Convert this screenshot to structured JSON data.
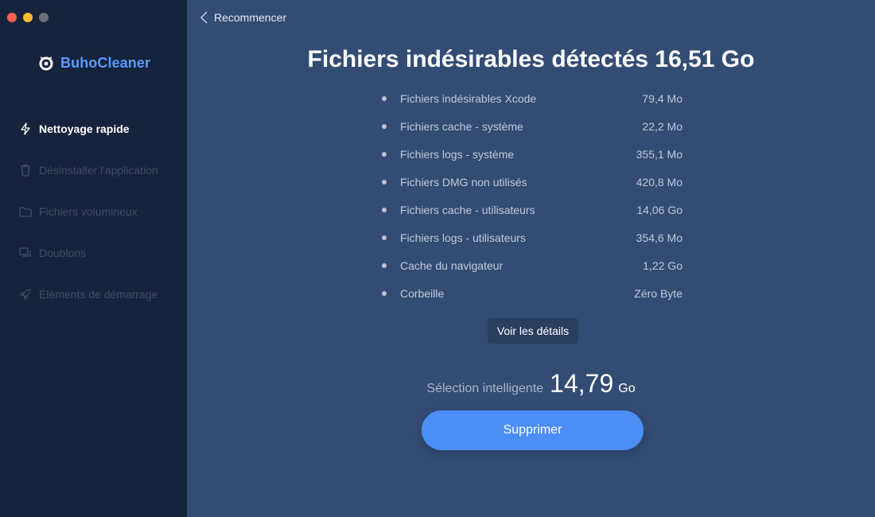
{
  "app": {
    "name": "BuhoCleaner"
  },
  "colors": {
    "accent": "#4b8ef5",
    "brand": "#5a9bff",
    "sidebar_bg": "#16233d",
    "main_bg": "#334c74"
  },
  "sidebar": {
    "items": [
      {
        "label": "Nettoyage rapide",
        "icon": "lightning-icon",
        "active": true
      },
      {
        "label": "Désinstaller l'application",
        "icon": "trash-icon",
        "active": false
      },
      {
        "label": "Fichiers volumineux",
        "icon": "folder-icon",
        "active": false
      },
      {
        "label": "Doublons",
        "icon": "duplicates-icon",
        "active": false
      },
      {
        "label": "Éléments de démarrage",
        "icon": "rocket-icon",
        "active": false
      }
    ]
  },
  "header": {
    "back_label": "Recommencer"
  },
  "main": {
    "title": "Fichiers indésirables détectés 16,51 Go",
    "items": [
      {
        "name": "Fichiers indésirables Xcode",
        "size": "79,4 Mo"
      },
      {
        "name": "Fichiers cache - système",
        "size": "22,2 Mo"
      },
      {
        "name": "Fichiers logs - système",
        "size": "355,1 Mo"
      },
      {
        "name": "Fichiers DMG non utilisés",
        "size": "420,8 Mo"
      },
      {
        "name": "Fichiers cache - utilisateurs",
        "size": "14,06 Go"
      },
      {
        "name": "Fichiers logs - utilisateurs",
        "size": "354,6 Mo"
      },
      {
        "name": "Cache du navigateur",
        "size": "1,22 Go"
      },
      {
        "name": "Corbeille",
        "size": "Zéro Byte"
      }
    ],
    "details_label": "Voir les détails",
    "smart_label": "Sélection intelligente",
    "smart_value": "14,79",
    "smart_unit": "Go",
    "delete_label": "Supprimer"
  }
}
